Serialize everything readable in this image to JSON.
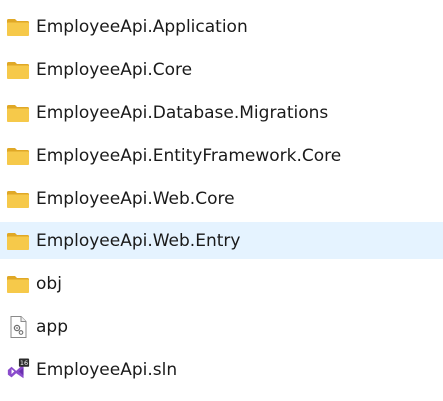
{
  "colors": {
    "selected_row_bg": "#e5f3ff",
    "folder": "#f2c94c",
    "folder_dark": "#e0a826",
    "vs_purple": "#7b3fbf"
  },
  "items": [
    {
      "name": "EmployeeApi.Application",
      "icon": "folder-icon",
      "selected": false
    },
    {
      "name": "EmployeeApi.Core",
      "icon": "folder-icon",
      "selected": false
    },
    {
      "name": "EmployeeApi.Database.Migrations",
      "icon": "folder-icon",
      "selected": false
    },
    {
      "name": "EmployeeApi.EntityFramework.Core",
      "icon": "folder-icon",
      "selected": false
    },
    {
      "name": "EmployeeApi.Web.Core",
      "icon": "folder-icon",
      "selected": false
    },
    {
      "name": "EmployeeApi.Web.Entry",
      "icon": "folder-icon",
      "selected": true
    },
    {
      "name": "obj",
      "icon": "folder-icon",
      "selected": false
    },
    {
      "name": "app",
      "icon": "config-file-icon",
      "selected": false
    },
    {
      "name": "EmployeeApi.sln",
      "icon": "visual-studio-solution-icon",
      "selected": false,
      "badge": "16"
    }
  ]
}
